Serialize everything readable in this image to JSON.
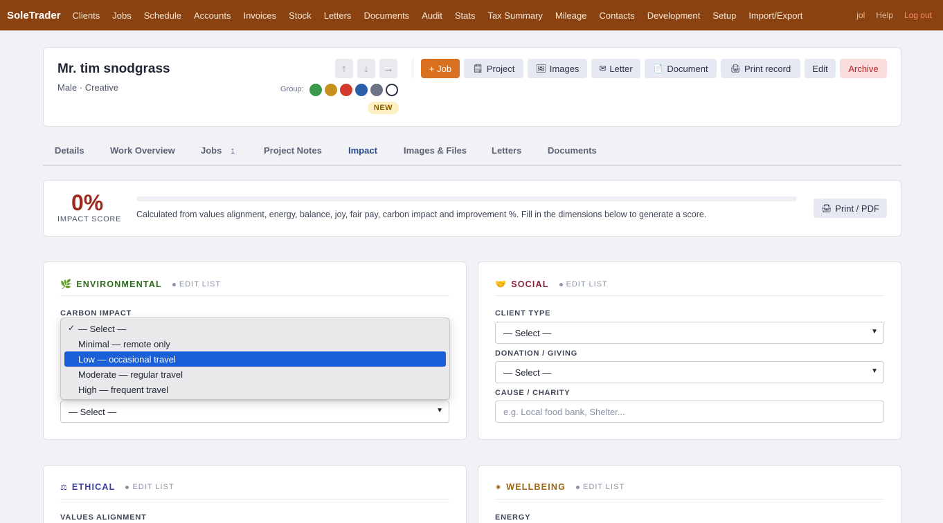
{
  "nav": {
    "brand": "SoleTrader",
    "links": [
      "Clients",
      "Jobs",
      "Schedule",
      "Accounts",
      "Invoices",
      "Stock",
      "Letters",
      "Documents",
      "Audit",
      "Stats",
      "Tax Summary",
      "Mileage",
      "Contacts",
      "Development",
      "Setup",
      "Import/Export"
    ],
    "user": "jol",
    "help": "Help",
    "logout": "Log out"
  },
  "client": {
    "name": "Mr. tim snodgrass",
    "meta": "Male · Creative",
    "group_label": "Group:",
    "group_colors": [
      "#3a9a4a",
      "#c89020",
      "#d23a2e",
      "#2a5ea8",
      "#6b7385"
    ],
    "badge": "NEW",
    "arrows": [
      "↑",
      "↓",
      "→"
    ],
    "actions": {
      "job": "+ Job",
      "project": "Project",
      "images": "Images",
      "letter": "Letter",
      "document": "Document",
      "print_record": "Print record",
      "edit": "Edit",
      "archive": "Archive"
    }
  },
  "tabs": [
    {
      "label": "Details"
    },
    {
      "label": "Work Overview"
    },
    {
      "label": "Jobs",
      "count": "1"
    },
    {
      "label": "Project Notes"
    },
    {
      "label": "Impact",
      "active": true
    },
    {
      "label": "Images & Files"
    },
    {
      "label": "Letters"
    },
    {
      "label": "Documents"
    }
  ],
  "impact": {
    "score": "0%",
    "score_value": 0,
    "score_label": "IMPACT SCORE",
    "description": "Calculated from values alignment, energy, balance, joy, fair pay, carbon impact and improvement %. Fill in the dimensions below to generate a score.",
    "print": "Print / PDF"
  },
  "sections": {
    "edit_list": "EDIT LIST",
    "environmental": {
      "title": "ENVIRONMENTAL",
      "color": "#2e6a1e",
      "carbon_label": "CARBON IMPACT",
      "second_select": "— Select —"
    },
    "social": {
      "title": "SOCIAL",
      "color": "#8a1f3a",
      "client_type_label": "CLIENT TYPE",
      "client_type_value": "— Select —",
      "donation_label": "DONATION / GIVING",
      "donation_value": "— Select —",
      "cause_label": "CAUSE / CHARITY",
      "cause_placeholder": "e.g. Local food bank, Shelter..."
    },
    "ethical": {
      "title": "ETHICAL",
      "color": "#3a3aa0",
      "field_label": "VALUES ALIGNMENT"
    },
    "wellbeing": {
      "title": "WELLBEING",
      "color": "#a06410",
      "field_label": "ENERGY"
    }
  },
  "dropdown": {
    "options": [
      "— Select —",
      "Minimal — remote only",
      "Low — occasional travel",
      "Moderate — regular travel",
      "High — frequent travel"
    ],
    "selected": "— Select —",
    "highlighted": "Low — occasional travel"
  }
}
